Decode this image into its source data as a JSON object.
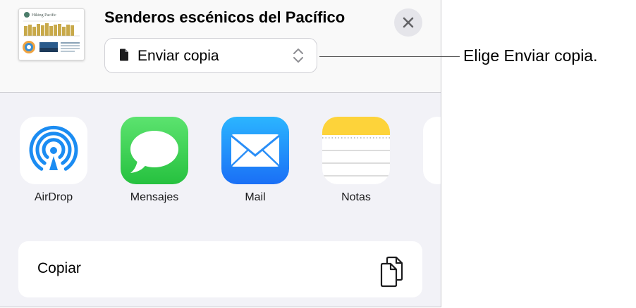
{
  "share_sheet": {
    "document_title": "Senderos escénicos del Pacífico",
    "thumbnail_title": "Hiking Pacific",
    "mode_button_label": "Enviar copia",
    "apps": [
      {
        "label": "AirDrop",
        "icon": "airdrop-icon"
      },
      {
        "label": "Mensajes",
        "icon": "messages-icon"
      },
      {
        "label": "Mail",
        "icon": "mail-icon"
      },
      {
        "label": "Notas",
        "icon": "notes-icon"
      }
    ],
    "actions": [
      {
        "label": "Copiar",
        "icon": "copy-icon"
      }
    ],
    "close_icon": "close-icon"
  },
  "callout": {
    "text": "Elige Enviar copia."
  },
  "colors": {
    "sheet_background": "#f2f2f7",
    "header_background": "#f9f9f9",
    "airdrop_blue": "#1b8cf2",
    "messages_green": "#34c759",
    "mail_blue": "#1a82fb",
    "notes_yellow": "#fdd33a"
  }
}
